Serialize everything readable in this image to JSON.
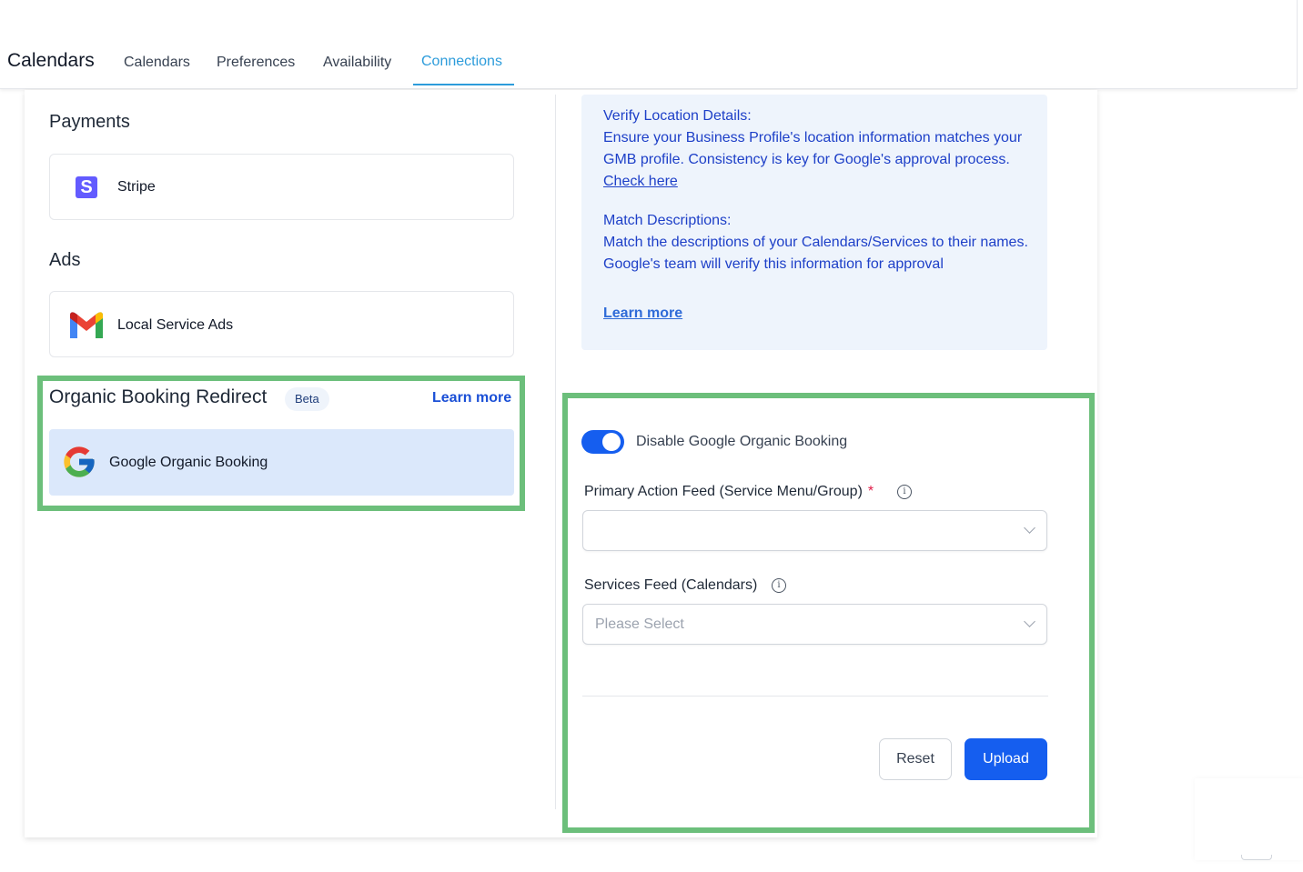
{
  "header": {
    "app_title": "Calendars",
    "tabs": [
      {
        "label": "Calendars"
      },
      {
        "label": "Preferences"
      },
      {
        "label": "Availability"
      },
      {
        "label": "Connections",
        "active": true
      }
    ]
  },
  "payments": {
    "title": "Payments",
    "items": [
      {
        "label": "Stripe",
        "icon": "stripe-icon"
      }
    ]
  },
  "ads": {
    "title": "Ads",
    "items": [
      {
        "label": "Local Service Ads",
        "icon": "gmail-icon"
      }
    ]
  },
  "organic": {
    "title": "Organic Booking Redirect",
    "badge": "Beta",
    "learn_more": "Learn more",
    "item": {
      "label": "Google Organic Booking",
      "icon": "google-icon"
    }
  },
  "info": {
    "verify_heading": "Verify Location Details:",
    "verify_body": "Ensure your Business Profile's location information matches your GMB profile. Consistency is key for Google's approval process.",
    "verify_link": "Check here",
    "match_heading": "Match Descriptions:",
    "match_body": "Match the descriptions of your Calendars/Services to their names. Google's team will verify this information for approval",
    "learn_more": "Learn more"
  },
  "form": {
    "toggle_label": "Disable Google Organic Booking",
    "toggle_on": true,
    "primary_label": "Primary Action Feed (Service Menu/Group)",
    "required_mark": "*",
    "primary_value": "",
    "services_label": "Services Feed (Calendars)",
    "services_placeholder": "Please Select",
    "reset_label": "Reset",
    "upload_label": "Upload"
  },
  "colors": {
    "accent": "#155eef",
    "tab_active": "#2d9cdb",
    "highlight": "#6cbf7b",
    "info_bg": "#eef4fc"
  }
}
